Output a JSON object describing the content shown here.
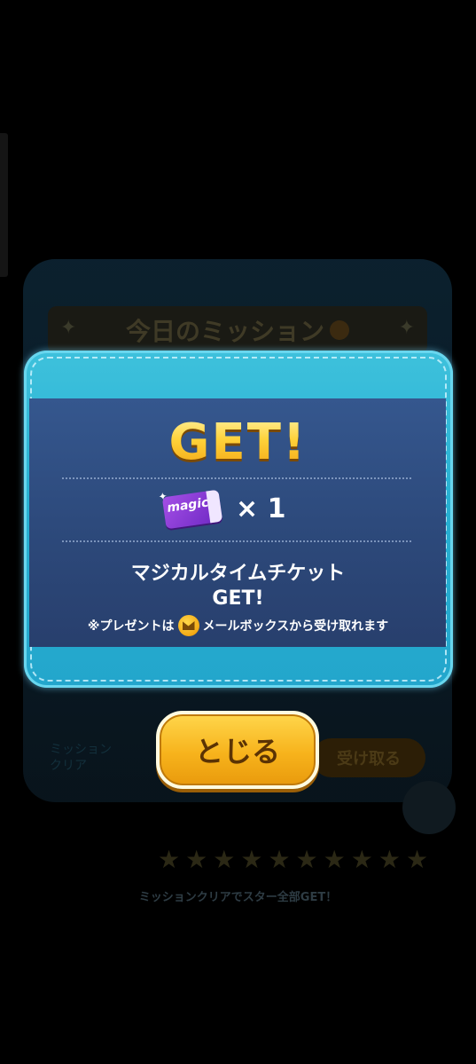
{
  "background": {
    "mission_title": "今日のミッション",
    "receive_button": "受け取る",
    "row_text_1": "ミッション",
    "row_text_2": "クリア",
    "star_caption": "ミッションクリアでスター全部GET！",
    "stars_count": 10
  },
  "reward": {
    "title": "GET!",
    "item_icon": "magic-ticket-icon",
    "item_icon_text": "magic",
    "quantity": "× 1",
    "message_line1": "マジカルタイムチケット",
    "message_line2": "GET!",
    "note_prefix": "※プレゼントは",
    "note_icon": "mail-icon",
    "note_suffix": "メールボックスから受け取れます"
  },
  "close_button": {
    "label": "とじる"
  },
  "colors": {
    "frame": "#27b0d2",
    "inner_panel": "#2d4a7c",
    "title_gold": "#ffd23a",
    "button": "#f7b31c",
    "button_text": "#5b3304"
  }
}
